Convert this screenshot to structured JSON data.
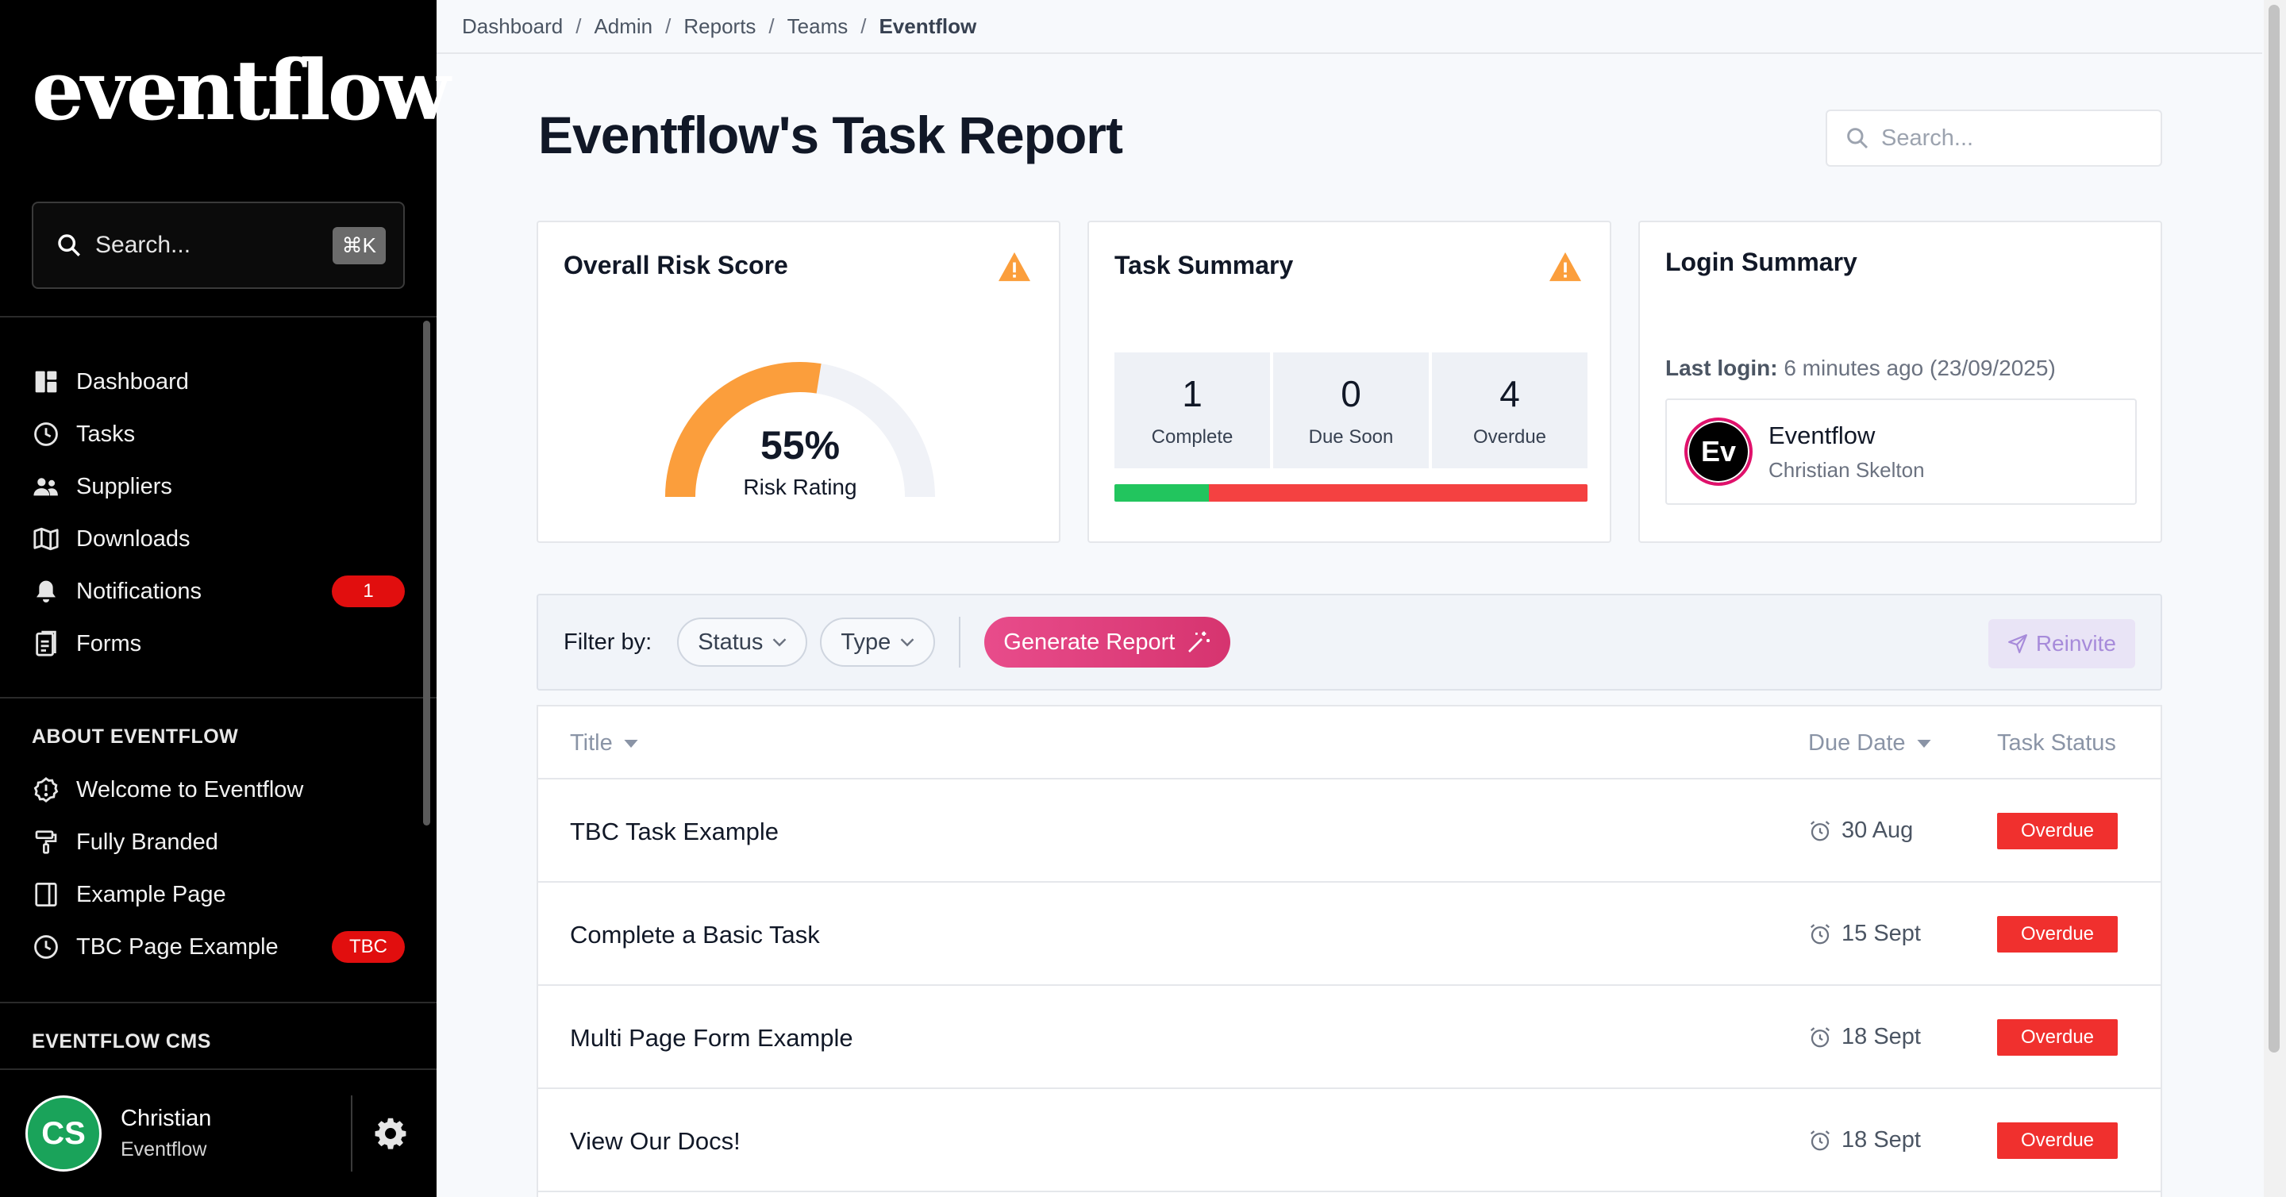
{
  "sidebar": {
    "brand": "eventflow",
    "brand_mark": "®",
    "search_placeholder": "Search...",
    "search_shortcut": "⌘K",
    "nav": [
      {
        "label": "Dashboard",
        "icon": "dashboard-icon"
      },
      {
        "label": "Tasks",
        "icon": "clock-icon"
      },
      {
        "label": "Suppliers",
        "icon": "users-icon"
      },
      {
        "label": "Downloads",
        "icon": "map-icon"
      },
      {
        "label": "Notifications",
        "icon": "bell-icon",
        "badge": "1"
      },
      {
        "label": "Forms",
        "icon": "document-icon"
      }
    ],
    "section_about": "ABOUT EVENTFLOW",
    "about": [
      {
        "label": "Welcome to Eventflow",
        "icon": "alert-badge-icon"
      },
      {
        "label": "Fully Branded",
        "icon": "paint-roller-icon"
      },
      {
        "label": "Example Page",
        "icon": "sidebar-layout-icon"
      },
      {
        "label": "TBC Page Example",
        "icon": "clock-icon",
        "badge": "TBC"
      }
    ],
    "section_cms": "EVENTFLOW CMS",
    "user": {
      "initials": "CS",
      "name": "Christian",
      "org": "Eventflow"
    }
  },
  "breadcrumb": [
    "Dashboard",
    "Admin",
    "Reports",
    "Teams",
    "Eventflow"
  ],
  "page": {
    "title": "Eventflow's Task Report",
    "search_placeholder": "Search..."
  },
  "risk": {
    "title": "Overall Risk Score",
    "value_text": "55%",
    "value": 55,
    "label": "Risk Rating",
    "color": "#fb9e3c"
  },
  "task_summary": {
    "title": "Task Summary",
    "stats": [
      {
        "num": "1",
        "label": "Complete"
      },
      {
        "num": "0",
        "label": "Due Soon"
      },
      {
        "num": "4",
        "label": "Overdue"
      }
    ],
    "complete_fraction": 0.2,
    "colors": {
      "complete": "#22c55e",
      "overdue": "#f44141"
    }
  },
  "login": {
    "title": "Login Summary",
    "last_login_label": "Last login:",
    "last_login_value": " 6 minutes ago (23/09/2025)",
    "avatar": "Ev",
    "name": "Eventflow",
    "user": "Christian Skelton"
  },
  "filters": {
    "label": "Filter by:",
    "status": "Status",
    "type": "Type",
    "generate": "Generate Report",
    "reinvite": "Reinvite"
  },
  "table": {
    "headers": {
      "title": "Title",
      "due": "Due Date",
      "status": "Task Status"
    },
    "rows": [
      {
        "title": "TBC Task Example",
        "due": "30 Aug",
        "status": "Overdue"
      },
      {
        "title": "Complete a Basic Task",
        "due": "15 Sept",
        "status": "Overdue"
      },
      {
        "title": "Multi Page Form Example",
        "due": "18 Sept",
        "status": "Overdue"
      },
      {
        "title": "View Our Docs!",
        "due": "18 Sept",
        "status": "Overdue"
      }
    ]
  }
}
